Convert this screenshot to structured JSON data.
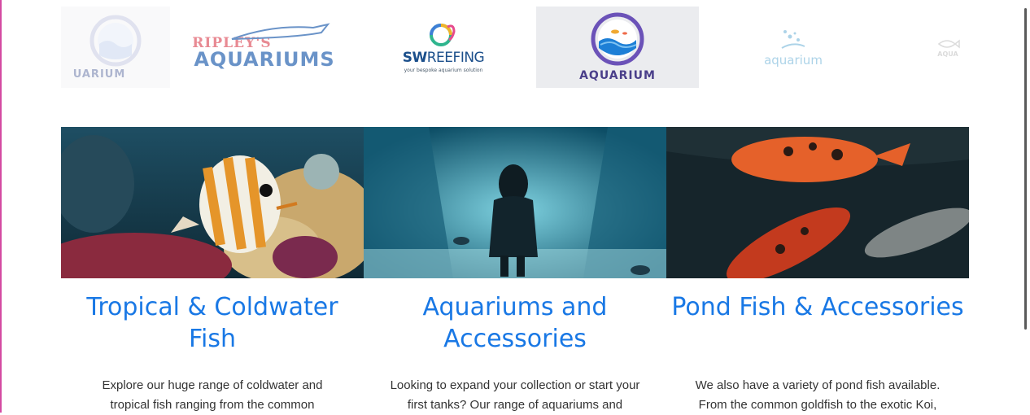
{
  "logos": {
    "items": [
      {
        "name": "aquarium-faded-left",
        "text": "UARIUM"
      },
      {
        "name": "ripleys-aquariums",
        "top": "RIPLEY'S",
        "main": "AQUARIUMS"
      },
      {
        "name": "swreefing",
        "main_a": "SW",
        "main_b": "REEFING",
        "tagline": "your bespoke aquarium solution"
      },
      {
        "name": "aquarium-main",
        "text": "AQUARIUM"
      },
      {
        "name": "aquarium-light",
        "text": "aquarium"
      },
      {
        "name": "aquarium-faded-right",
        "text": "AQUA"
      }
    ]
  },
  "cards": [
    {
      "title": "Tropical & Coldwater Fish",
      "text": "Explore our huge range of coldwater and tropical fish ranging from the common"
    },
    {
      "title": "Aquariums and Accessories",
      "text": "Looking to expand your collection or start your first tanks? Our range of aquariums and"
    },
    {
      "title": "Pond Fish & Accessories",
      "text": "We also have a variety of pond fish available. From the common goldfish to the exotic Koi,"
    }
  ],
  "colors": {
    "title_blue": "#1978e5",
    "frame_pink": "#d44aa2",
    "body_text": "#333333"
  }
}
